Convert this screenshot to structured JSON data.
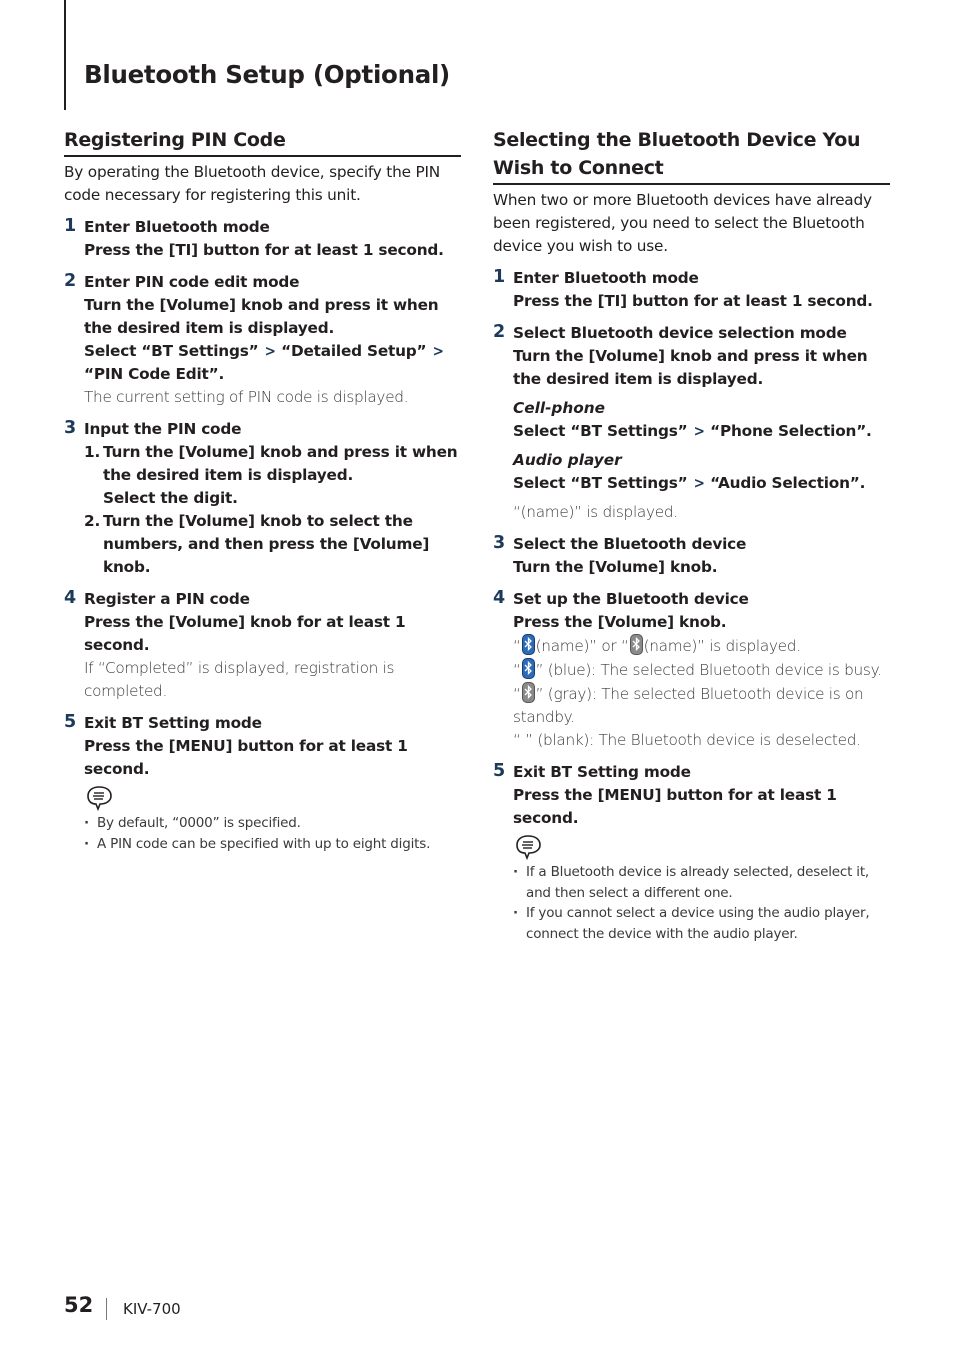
{
  "page": {
    "title": "Bluetooth Setup (Optional)",
    "page_number": "52",
    "model": "KIV-700"
  },
  "left": {
    "title": "Registering PIN Code",
    "intro": "By operating the Bluetooth device, specify the PIN code necessary for registering this unit.",
    "steps": [
      {
        "num": "1",
        "title": "Enter Bluetooth mode",
        "action": "Press the [TI] button for at least 1 second."
      },
      {
        "num": "2",
        "title": "Enter PIN code edit mode",
        "action": "Turn the [Volume] knob and press it when the desired item is displayed.",
        "select_prefix": "Select “BT Settings”",
        "select_mid": "“Detailed Setup”",
        "select_end": "“PIN Code Edit”.",
        "note": "The current setting of PIN code is displayed."
      },
      {
        "num": "3",
        "title": "Input the PIN code",
        "substeps": [
          {
            "num": "1.",
            "text": "Turn the [Volume] knob and press it when the desired item is displayed.",
            "extra": "Select the digit."
          },
          {
            "num": "2.",
            "text": "Turn the [Volume] knob to select the numbers, and then press the [Volume] knob."
          }
        ]
      },
      {
        "num": "4",
        "title": "Register a PIN code",
        "action": "Press the [Volume] knob for at least 1 second.",
        "note": "If “Completed” is displayed, registration is completed."
      },
      {
        "num": "5",
        "title": "Exit BT Setting mode",
        "action": "Press the [MENU] button for at least 1 second."
      }
    ],
    "notes": [
      "By default, “0000” is specified.",
      "A PIN code can be specified with up to eight digits."
    ]
  },
  "right": {
    "title": "Selecting the Bluetooth Device You Wish to Connect",
    "intro": "When two or more Bluetooth devices have already been registered, you need to select the Bluetooth device you wish to use.",
    "steps": [
      {
        "num": "1",
        "title": "Enter Bluetooth mode",
        "action": "Press the [TI] button for at least 1 second."
      },
      {
        "num": "2",
        "title": "Select Bluetooth device selection mode",
        "action": "Turn the [Volume] knob and press it when the desired item is displayed.",
        "cell_label": "Cell-phone",
        "cell_prefix": "Select “BT Settings”",
        "cell_end": "“Phone Selection”.",
        "audio_label": "Audio player",
        "audio_prefix": "Select “BT Settings”",
        "audio_end": "“Audio Selection”.",
        "note": "“(name)” is displayed."
      },
      {
        "num": "3",
        "title": "Select the Bluetooth device",
        "action": "Turn the [Volume] knob."
      },
      {
        "num": "4",
        "title": "Set up the Bluetooth device",
        "action": "Press the [Volume] knob.",
        "display_a": "(name)” or “",
        "display_b": "(name)” is displayed.",
        "legend": [
          {
            "key": "” (blue):",
            "text": "The selected Bluetooth device is busy.",
            "color": "#2b6cb8"
          },
          {
            "key": "” (gray):",
            "text": "The selected Bluetooth device is on standby.",
            "color": "#8a8a8a"
          },
          {
            "key": "“  ” (blank):",
            "text": "The Bluetooth device is deselected."
          }
        ]
      },
      {
        "num": "5",
        "title": "Exit BT Setting mode",
        "action": "Press the [MENU] button for at least 1 second."
      }
    ],
    "notes": [
      "If a Bluetooth device is already selected, deselect it, and then select a different one.",
      "If you cannot select a device using the audio player, connect the device with the audio player."
    ]
  },
  "icons": {
    "arrow": ">",
    "open_quote": "“"
  }
}
